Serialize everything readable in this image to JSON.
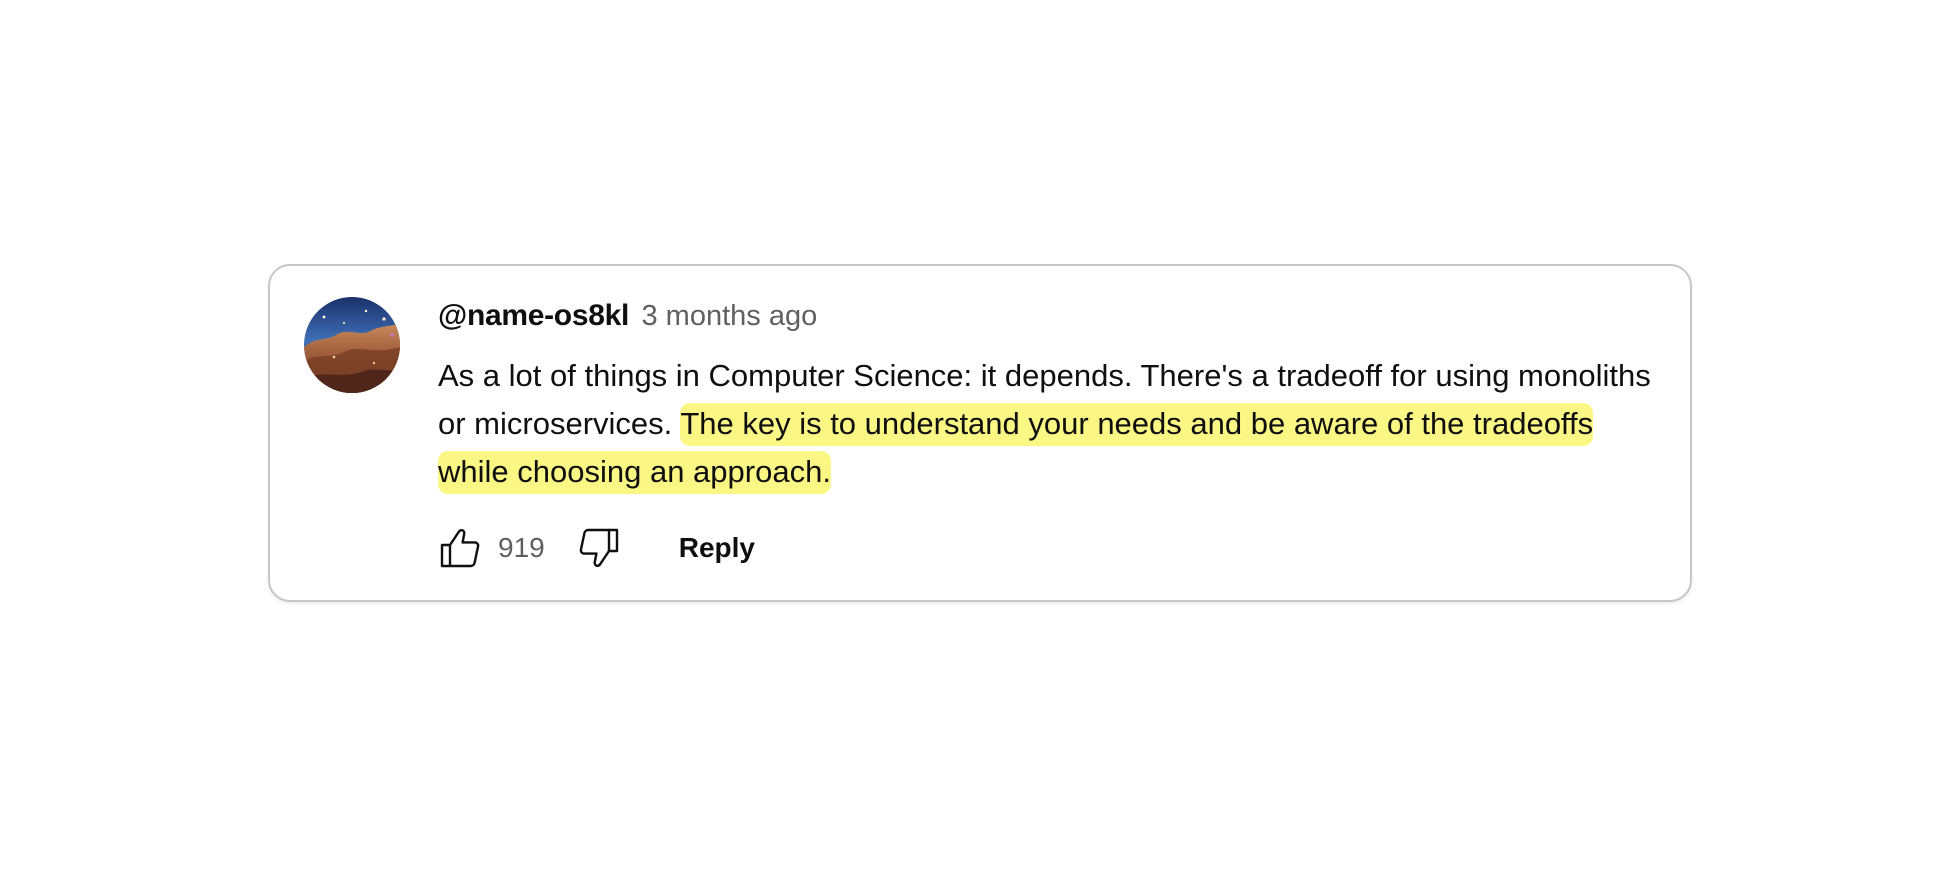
{
  "comment": {
    "author": "@name-os8kl",
    "timestamp": "3 months ago",
    "text_plain": "As a lot of things in Computer Science: it depends. There's a tradeoff for using monoliths or microservices. ",
    "text_highlighted": "The key is to understand your needs and be aware of the tradeoffs while choosing an approach.",
    "avatar_icon": "nebula-avatar-icon"
  },
  "actions": {
    "like_icon": "thumbs-up-icon",
    "like_count": "919",
    "dislike_icon": "thumbs-down-icon",
    "reply_label": "Reply"
  },
  "colors": {
    "highlight": "#fbf785",
    "border": "#c7c7c7",
    "muted_text": "#606060",
    "primary_text": "#0f0f0f"
  }
}
